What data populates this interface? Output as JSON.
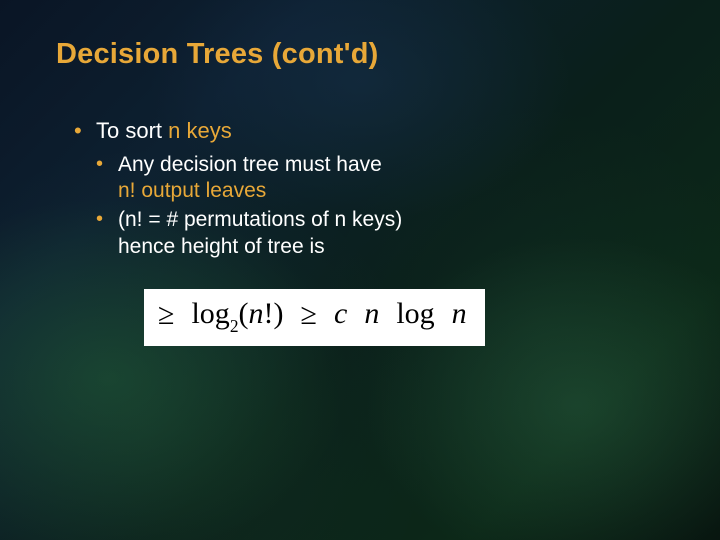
{
  "title": "Decision Trees (cont'd)",
  "bullets": {
    "l1": {
      "prefix": "To sort ",
      "accent": "n keys"
    },
    "l2a": {
      "line1": "Any decision tree must have",
      "accent": "n! output leaves"
    },
    "l2b": {
      "line1": "(n! = # permutations of n keys)",
      "line2": "hence height of tree is"
    }
  },
  "formula": {
    "ge1": "≥",
    "log": "log",
    "sub": "2",
    "arg_open": "(",
    "n": "n",
    "bang": "!",
    "arg_close": ")",
    "ge2": "≥",
    "c": "c",
    "n2": "n",
    "log2": "log",
    "n3": "n"
  }
}
